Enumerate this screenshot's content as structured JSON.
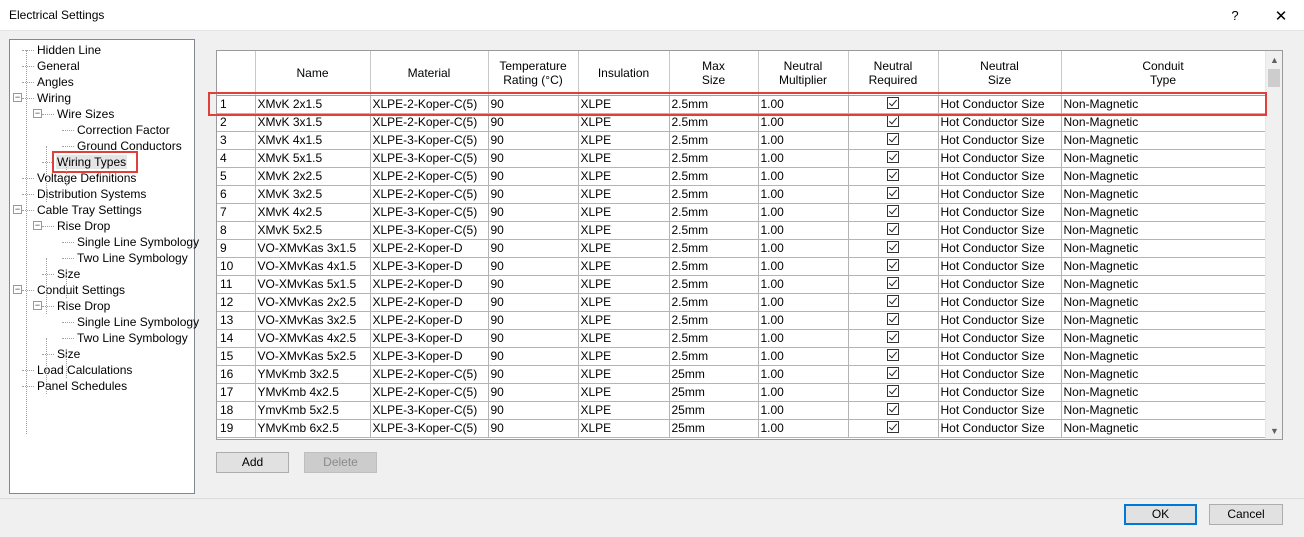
{
  "window": {
    "title": "Electrical Settings",
    "help": "?",
    "close": "✕"
  },
  "tree": [
    {
      "label": "Hidden Line",
      "level": 0
    },
    {
      "label": "General",
      "level": 0
    },
    {
      "label": "Angles",
      "level": 0
    },
    {
      "label": "Wiring",
      "level": 0,
      "expander": "−"
    },
    {
      "label": "Wire Sizes",
      "level": 1,
      "expander": "−"
    },
    {
      "label": "Correction Factor",
      "level": 2
    },
    {
      "label": "Ground Conductors",
      "level": 2
    },
    {
      "label": "Wiring Types",
      "level": 1,
      "selected": true
    },
    {
      "label": "Voltage Definitions",
      "level": 0
    },
    {
      "label": "Distribution Systems",
      "level": 0
    },
    {
      "label": "Cable Tray Settings",
      "level": 0,
      "expander": "−"
    },
    {
      "label": "Rise Drop",
      "level": 1,
      "expander": "−"
    },
    {
      "label": "Single Line Symbology",
      "level": 2
    },
    {
      "label": "Two Line Symbology",
      "level": 2
    },
    {
      "label": "Size",
      "level": 1
    },
    {
      "label": "Conduit Settings",
      "level": 0,
      "expander": "−"
    },
    {
      "label": "Rise Drop",
      "level": 1,
      "expander": "−"
    },
    {
      "label": "Single Line Symbology",
      "level": 2
    },
    {
      "label": "Two Line Symbology",
      "level": 2
    },
    {
      "label": "Size",
      "level": 1
    },
    {
      "label": "Load Calculations",
      "level": 0
    },
    {
      "label": "Panel Schedules",
      "level": 0
    }
  ],
  "table": {
    "columns": [
      "",
      "Name",
      "Material",
      "Temperature\nRating (°C)",
      "Insulation",
      "Max\nSize",
      "Neutral\nMultiplier",
      "Neutral\nRequired",
      "Neutral\nSize",
      "Conduit\nType"
    ],
    "rows": [
      [
        "1",
        "XMvK 2x1.5",
        "XLPE-2-Koper-C(5)",
        "90",
        "XLPE",
        "2.5mm",
        "1.00",
        true,
        "Hot Conductor Size",
        "Non-Magnetic"
      ],
      [
        "2",
        "XMvK 3x1.5",
        "XLPE-2-Koper-C(5)",
        "90",
        "XLPE",
        "2.5mm",
        "1.00",
        true,
        "Hot Conductor Size",
        "Non-Magnetic"
      ],
      [
        "3",
        "XMvK 4x1.5",
        "XLPE-3-Koper-C(5)",
        "90",
        "XLPE",
        "2.5mm",
        "1.00",
        true,
        "Hot Conductor Size",
        "Non-Magnetic"
      ],
      [
        "4",
        "XMvK 5x1.5",
        "XLPE-3-Koper-C(5)",
        "90",
        "XLPE",
        "2.5mm",
        "1.00",
        true,
        "Hot Conductor Size",
        "Non-Magnetic"
      ],
      [
        "5",
        "XMvK 2x2.5",
        "XLPE-2-Koper-C(5)",
        "90",
        "XLPE",
        "2.5mm",
        "1.00",
        true,
        "Hot Conductor Size",
        "Non-Magnetic"
      ],
      [
        "6",
        "XMvK 3x2.5",
        "XLPE-2-Koper-C(5)",
        "90",
        "XLPE",
        "2.5mm",
        "1.00",
        true,
        "Hot Conductor Size",
        "Non-Magnetic"
      ],
      [
        "7",
        "XMvK 4x2.5",
        "XLPE-3-Koper-C(5)",
        "90",
        "XLPE",
        "2.5mm",
        "1.00",
        true,
        "Hot Conductor Size",
        "Non-Magnetic"
      ],
      [
        "8",
        "XMvK 5x2.5",
        "XLPE-3-Koper-C(5)",
        "90",
        "XLPE",
        "2.5mm",
        "1.00",
        true,
        "Hot Conductor Size",
        "Non-Magnetic"
      ],
      [
        "9",
        "VO-XMvKas 3x1.5",
        "XLPE-2-Koper-D",
        "90",
        "XLPE",
        "2.5mm",
        "1.00",
        true,
        "Hot Conductor Size",
        "Non-Magnetic"
      ],
      [
        "10",
        "VO-XMvKas 4x1.5",
        "XLPE-3-Koper-D",
        "90",
        "XLPE",
        "2.5mm",
        "1.00",
        true,
        "Hot Conductor Size",
        "Non-Magnetic"
      ],
      [
        "11",
        "VO-XMvKas 5x1.5",
        "XLPE-2-Koper-D",
        "90",
        "XLPE",
        "2.5mm",
        "1.00",
        true,
        "Hot Conductor Size",
        "Non-Magnetic"
      ],
      [
        "12",
        "VO-XMvKas 2x2.5",
        "XLPE-2-Koper-D",
        "90",
        "XLPE",
        "2.5mm",
        "1.00",
        true,
        "Hot Conductor Size",
        "Non-Magnetic"
      ],
      [
        "13",
        "VO-XMvKas 3x2.5",
        "XLPE-2-Koper-D",
        "90",
        "XLPE",
        "2.5mm",
        "1.00",
        true,
        "Hot Conductor Size",
        "Non-Magnetic"
      ],
      [
        "14",
        "VO-XMvKas 4x2.5",
        "XLPE-3-Koper-D",
        "90",
        "XLPE",
        "2.5mm",
        "1.00",
        true,
        "Hot Conductor Size",
        "Non-Magnetic"
      ],
      [
        "15",
        "VO-XMvKas 5x2.5",
        "XLPE-3-Koper-D",
        "90",
        "XLPE",
        "2.5mm",
        "1.00",
        true,
        "Hot Conductor Size",
        "Non-Magnetic"
      ],
      [
        "16",
        "YMvKmb 3x2.5",
        "XLPE-2-Koper-C(5)",
        "90",
        "XLPE",
        "25mm",
        "1.00",
        true,
        "Hot Conductor Size",
        "Non-Magnetic"
      ],
      [
        "17",
        "YMvKmb 4x2.5",
        "XLPE-2-Koper-C(5)",
        "90",
        "XLPE",
        "25mm",
        "1.00",
        true,
        "Hot Conductor Size",
        "Non-Magnetic"
      ],
      [
        "18",
        "YmvKmb 5x2.5",
        "XLPE-3-Koper-C(5)",
        "90",
        "XLPE",
        "25mm",
        "1.00",
        true,
        "Hot Conductor Size",
        "Non-Magnetic"
      ],
      [
        "19",
        "YMvKmb 6x2.5",
        "XLPE-3-Koper-C(5)",
        "90",
        "XLPE",
        "25mm",
        "1.00",
        true,
        "Hot Conductor Size",
        "Non-Magnetic"
      ]
    ]
  },
  "buttons": {
    "add": "Add",
    "delete": "Delete",
    "ok": "OK",
    "cancel": "Cancel"
  },
  "colors": {
    "highlight": "#e0403a",
    "accent": "#0078d7"
  }
}
